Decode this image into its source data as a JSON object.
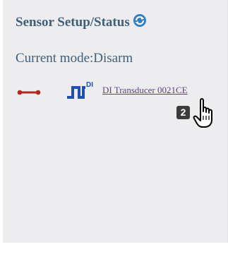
{
  "panel": {
    "title": "Sensor Setup/Status",
    "mode_text": "Current mode:Disarm"
  },
  "sensor": {
    "type_label": "DI",
    "name": "DI Transducer 0021CE",
    "status_icon": "disconnected-link-icon"
  },
  "overlay": {
    "step_number": "2",
    "cursor_icon": "hand-pointer-icon"
  },
  "colors": {
    "title": "#3f5f78",
    "link": "#5b3f8a",
    "status_red": "#b22a1e",
    "di_blue": "#1f4fb0",
    "refresh_blue": "#2e7fc7",
    "panel_bg": "#ededf0"
  }
}
